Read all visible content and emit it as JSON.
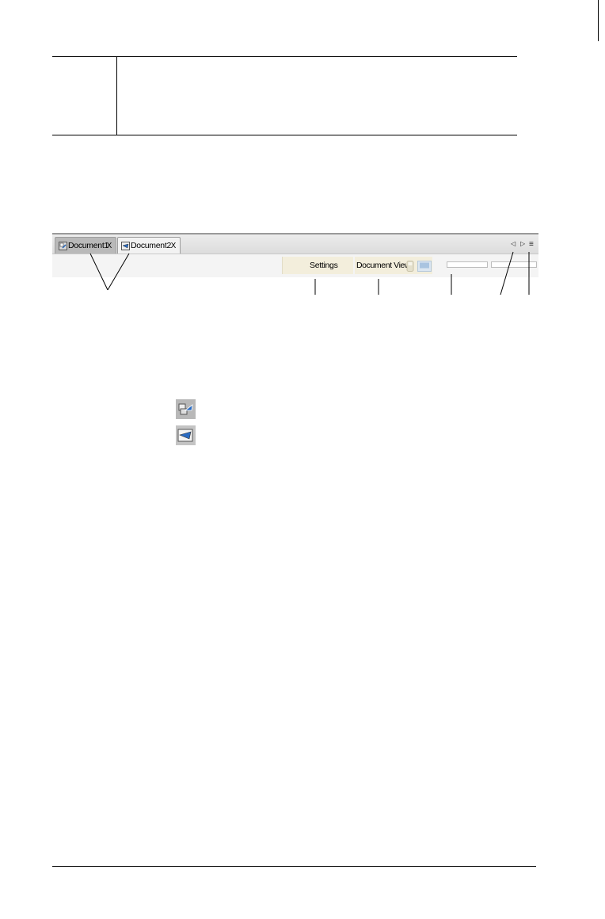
{
  "toolbar": {
    "tabs": [
      {
        "label": "Document1",
        "close": "X",
        "icon": "calculator-document-icon",
        "active": true
      },
      {
        "label": "Document2",
        "close": "X",
        "icon": "computer-document-icon",
        "active": false
      }
    ],
    "nav": {
      "prev": "◁",
      "next": "▷",
      "menu": "≡"
    },
    "settings_label": "Settings",
    "document_view_label": "Document View:"
  },
  "legend_icons": [
    {
      "name": "handheld-document-icon"
    },
    {
      "name": "computer-document-icon"
    }
  ]
}
